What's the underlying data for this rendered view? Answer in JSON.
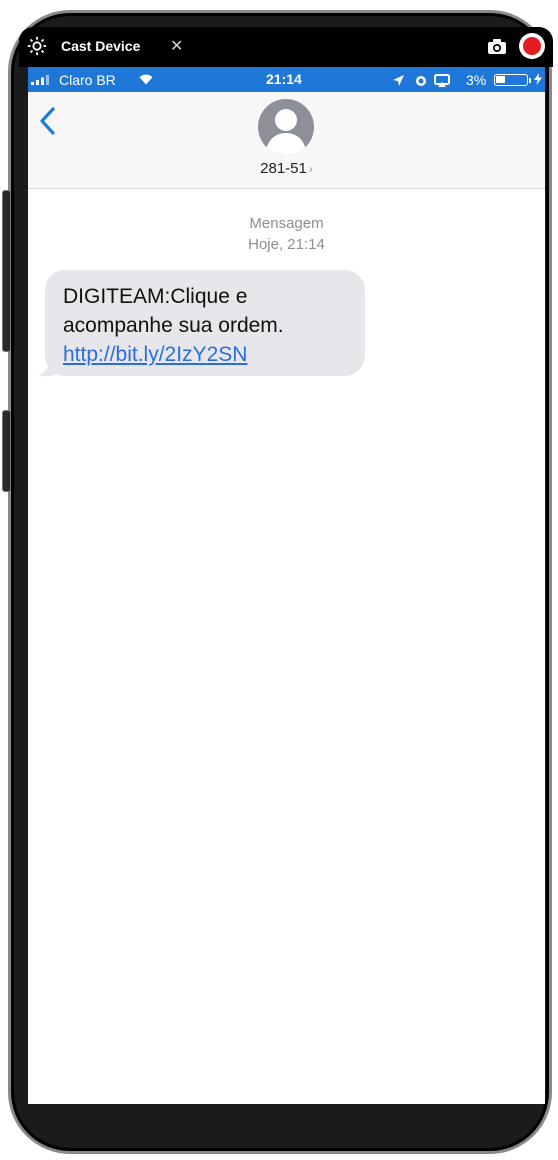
{
  "cast_bar": {
    "title": "Cast Device",
    "close_glyph": "✕",
    "icons": [
      "gear-icon",
      "camera-icon",
      "record-icon"
    ]
  },
  "status_bar": {
    "carrier": "Claro BR",
    "time": "21:14",
    "battery_percent": "3%",
    "battery_level": 0.03
  },
  "header": {
    "contact": "281-51",
    "chevron": "›"
  },
  "conversation": {
    "label": "Mensagem",
    "timestamp": "Hoje, 21:14",
    "messages": [
      {
        "line1": "DIGITEAM:Clique e",
        "line2": "acompanhe sua ordem.",
        "link": "http://bit.ly/2IzY2SN"
      }
    ]
  },
  "colors": {
    "status_bar": "#1f78d8",
    "bubble": "#e6e6eb",
    "link": "#2a6ede",
    "record": "#e31b23",
    "back": "#1f7ae0"
  }
}
